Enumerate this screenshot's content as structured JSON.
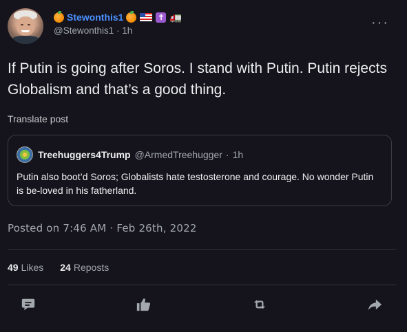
{
  "author": {
    "display_name": "Stewonthis1",
    "handle": "@Stewonthis1",
    "time": "1h",
    "separator": "·"
  },
  "icons": {
    "name_prefix": "orange-emoji",
    "name_suffix": [
      "orange-emoji",
      "us-flag-emoji",
      "latin-cross-emoji",
      "truck-emoji"
    ],
    "more": "more-icon",
    "reply": "reply-icon",
    "like": "thumbs-up-icon",
    "repost": "repost-icon",
    "share": "share-icon"
  },
  "post": {
    "text": "If Putin is going after Soros. I stand with Putin. Putin rejects Globalism and that’s a good thing.",
    "translate_label": "Translate post",
    "posted_label": "Posted on 7:46 AM · Feb 26th, 2022"
  },
  "quote": {
    "name": "Treehuggers4Trump",
    "handle": "@ArmedTreehugger",
    "separator": "·",
    "time": "1h",
    "text": "Putin also boot’d Soros; Globalists hate testosterone and courage. No wonder Putin is be-loved in his fatherland."
  },
  "stats": {
    "likes_count": "49",
    "likes_label": "Likes",
    "reposts_count": "24",
    "reposts_label": "Reposts"
  },
  "colors": {
    "background": "#15141c",
    "accent_name": "#4a90ff",
    "muted": "#a3a8ad",
    "text": "#e7e9ea"
  },
  "more_glyph": "···"
}
